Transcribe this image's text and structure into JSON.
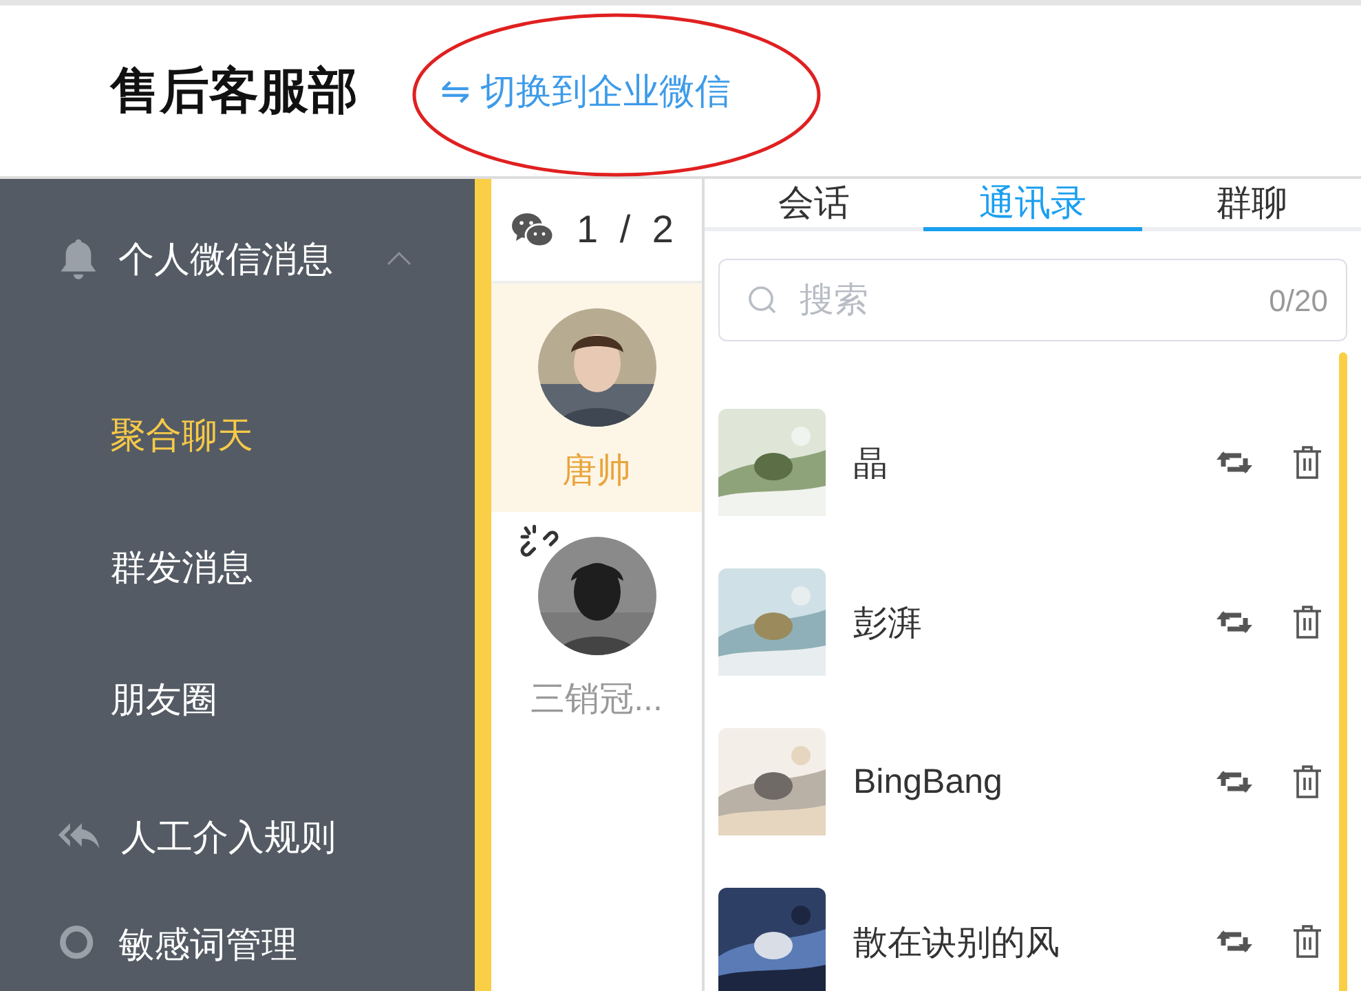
{
  "header": {
    "title": "售后客服部",
    "switch_link": "⇋ 切换到企业微信"
  },
  "sidebar": {
    "groups": [
      {
        "label": "个人微信消息",
        "expanded": true,
        "children": [
          {
            "label": "聚合聊天",
            "selected": true
          },
          {
            "label": "群发消息",
            "selected": false
          },
          {
            "label": "朋友圈",
            "selected": false
          }
        ]
      },
      {
        "label": "人工介入规则"
      },
      {
        "label": "敏感词管理"
      }
    ]
  },
  "accounts": {
    "counter": "1 / 2",
    "items": [
      {
        "name": "唐帅",
        "selected": true,
        "disconnected": false
      },
      {
        "name": "三销冠...",
        "selected": false,
        "disconnected": true
      }
    ]
  },
  "tabs": [
    {
      "label": "会话",
      "selected": false
    },
    {
      "label": "通讯录",
      "selected": true
    },
    {
      "label": "群聊",
      "selected": false
    }
  ],
  "search": {
    "placeholder": "搜索",
    "counter": "0/20"
  },
  "contacts": [
    {
      "name": "晶"
    },
    {
      "name": "彭湃"
    },
    {
      "name": "BingBang"
    },
    {
      "name": "散在诀别的风"
    }
  ]
}
